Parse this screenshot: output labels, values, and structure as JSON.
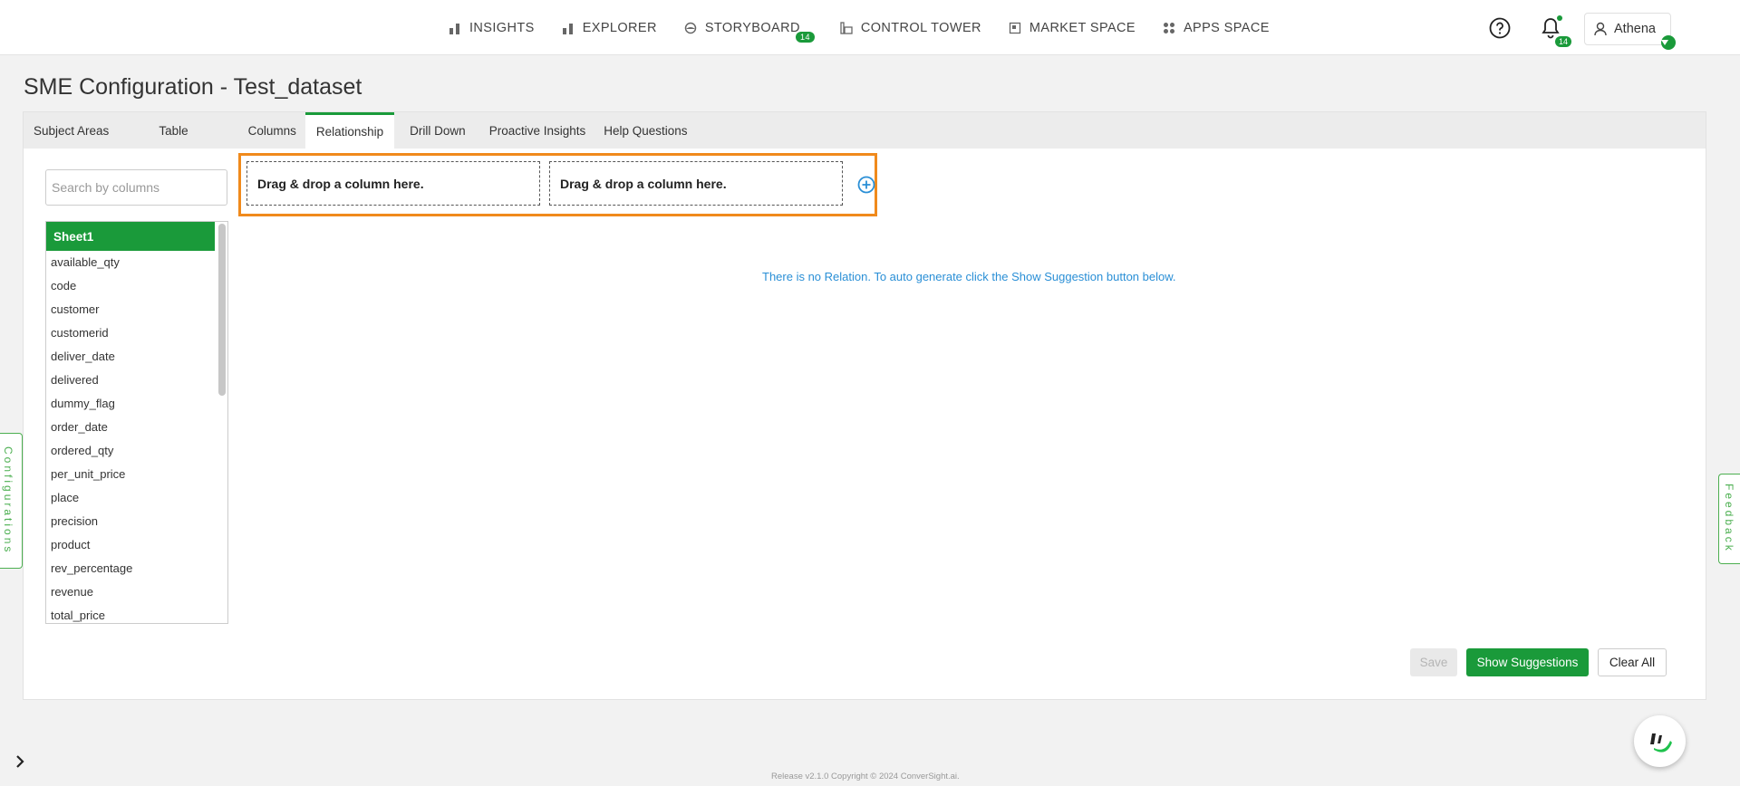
{
  "nav": {
    "items": [
      {
        "label": "INSIGHTS",
        "icon": "bar-chart-icon"
      },
      {
        "label": "EXPLORER",
        "icon": "bar-chart-icon"
      },
      {
        "label": "STORYBOARD",
        "icon": "storyboard-icon",
        "badge": "14"
      },
      {
        "label": "CONTROL TOWER",
        "icon": "control-tower-icon"
      },
      {
        "label": "MARKET SPACE",
        "icon": "market-space-icon"
      },
      {
        "label": "APPS SPACE",
        "icon": "apps-grid-icon"
      }
    ],
    "notifications_badge": "14",
    "user_name": "Athena"
  },
  "page": {
    "title": "SME Configuration - Test_dataset"
  },
  "tabs": [
    "Subject Areas",
    "Table",
    "Columns",
    "Relationship",
    "Drill Down",
    "Proactive Insights",
    "Help Questions"
  ],
  "active_tab": "Relationship",
  "search": {
    "placeholder": "Search by columns"
  },
  "columns": {
    "sheet": "Sheet1",
    "items": [
      "available_qty",
      "code",
      "customer",
      "customerid",
      "deliver_date",
      "delivered",
      "dummy_flag",
      "order_date",
      "ordered_qty",
      "per_unit_price",
      "place",
      "precision",
      "product",
      "rev_percentage",
      "revenue",
      "total_price"
    ]
  },
  "relationship": {
    "dropzone_left": "Drag & drop a column here.",
    "dropzone_right": "Drag & drop a column here.",
    "empty_message": "There is no Relation. To auto generate click the Show Suggestion button below."
  },
  "actions": {
    "save": "Save",
    "show_suggestions": "Show Suggestions",
    "clear_all": "Clear All"
  },
  "side": {
    "configurations": "Configurations",
    "feedback": "Feedback"
  },
  "footer": "Release v2.1.0 Copyright © 2024 ConverSight.ai.",
  "colors": {
    "accent": "#1a9a3a",
    "highlight": "#f08a1c",
    "link": "#2a8fd6"
  }
}
